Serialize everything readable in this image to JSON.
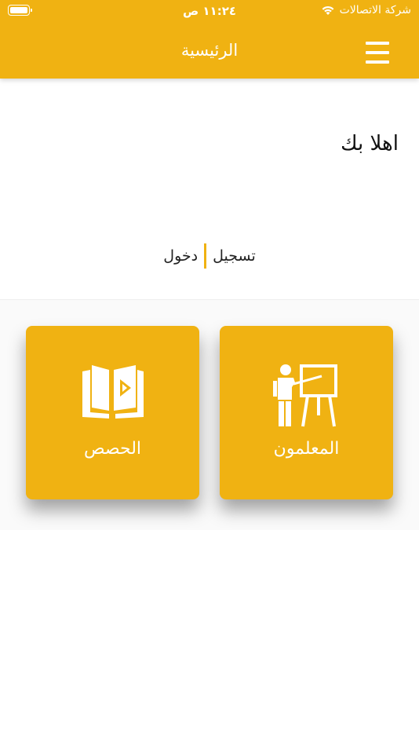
{
  "status_bar": {
    "time": "١١:٢٤ ص",
    "carrier": "شركة الاتصالات"
  },
  "header": {
    "title": "الرئيسية"
  },
  "welcome": {
    "text": "اهلا بك"
  },
  "auth": {
    "register_label": "تسجيل",
    "login_label": "دخول"
  },
  "cards": {
    "teachers_label": "المعلمون",
    "lessons_label": "الحصص"
  },
  "colors": {
    "accent": "#F0B212",
    "text": "#111111"
  }
}
